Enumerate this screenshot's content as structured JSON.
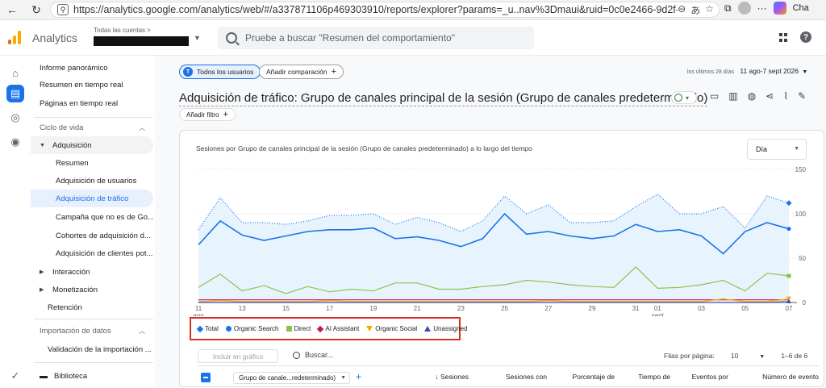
{
  "browser": {
    "url": "https://analytics.google.com/analytics/web/#/a337871106p469303910/reports/explorer?params=_u..nav%3Dmaui&ruid=0c0e2466-9d2f-...",
    "copilot_label": "Cha"
  },
  "header": {
    "brand": "Analytics",
    "account_label": "Todas las cuentas >",
    "search_placeholder": "Pruebe a buscar \"Resumen del comportamiento\""
  },
  "sidebar": {
    "items": [
      {
        "label": "Informe panorámico"
      },
      {
        "label": "Resumen en tiempo real"
      },
      {
        "label": "Páginas en tiempo real"
      },
      {
        "label": "Ciclo de vida"
      },
      {
        "label": "Adquisición"
      },
      {
        "label": "Resumen"
      },
      {
        "label": "Adquisición de usuarios"
      },
      {
        "label": "Adquisición de tráfico"
      },
      {
        "label": "Campaña que no es de Go..."
      },
      {
        "label": "Cohortes de adquisición d..."
      },
      {
        "label": "Adquisición de clientes pot..."
      },
      {
        "label": "Interacción"
      },
      {
        "label": "Monetización"
      },
      {
        "label": "Retención"
      },
      {
        "label": "Importación de datos"
      },
      {
        "label": "Validación de la importación ..."
      },
      {
        "label": "Biblioteca"
      }
    ]
  },
  "main": {
    "chip_users_letter": "T",
    "chip_users": "Todos los usuarios",
    "chip_compare": "Añadir comparación",
    "date_label": "los últimos 28 días",
    "date_value": "11 ago-7 sept 2026",
    "title": "Adquisición de tráfico: Grupo de canales principal de la sesión (Grupo de canales predeterminado)",
    "add_filter": "Añadir filtro",
    "chart_title": "Sesiones por Grupo de canales principal de la sesión (Grupo de canales predeterminado) a lo largo del tiempo",
    "granularity": "Día",
    "table": {
      "include_placeholder": "Incluir en gráfico",
      "search_label": "Buscar...",
      "rows_label": "Filas por página:",
      "rows_value": "10",
      "range": "1–6 de 6",
      "dimension": "Grupo de canale...redeterminado)",
      "columns": [
        "↓ Sesiones",
        "Sesiones con interacción",
        "Porcentaje de interacciones",
        "Tiempo de interacción",
        "Eventos por",
        "Número de evento Todos los eventos"
      ]
    }
  },
  "chart_data": {
    "type": "line",
    "x": [
      "11 ago",
      "12",
      "13",
      "14",
      "15",
      "16",
      "17",
      "18",
      "19",
      "20",
      "21",
      "22",
      "23",
      "24",
      "25",
      "26",
      "27",
      "28",
      "29",
      "30",
      "31",
      "01 sept",
      "02",
      "03",
      "04",
      "05",
      "06",
      "07"
    ],
    "x_tick_labels": [
      "11",
      "ago",
      "13",
      "15",
      "17",
      "19",
      "21",
      "23",
      "25",
      "27",
      "29",
      "31",
      "01",
      "sept",
      "03",
      "05",
      "07"
    ],
    "y_ticks": [
      0,
      50,
      100,
      150
    ],
    "ylim": [
      0,
      150
    ],
    "series": [
      {
        "name": "Total",
        "color": "#1a73e8",
        "style": "dotted-area",
        "values": [
          82,
          118,
          90,
          90,
          88,
          92,
          98,
          98,
          100,
          88,
          96,
          90,
          80,
          92,
          120,
          100,
          110,
          90,
          90,
          92,
          108,
          122,
          100,
          100,
          108,
          84,
          120,
          112
        ]
      },
      {
        "name": "Organic Search",
        "color": "#1a73e8",
        "style": "solid",
        "values": [
          65,
          92,
          76,
          70,
          75,
          80,
          82,
          82,
          84,
          72,
          74,
          70,
          63,
          72,
          100,
          77,
          80,
          75,
          72,
          75,
          88,
          80,
          82,
          75,
          55,
          80,
          90,
          83
        ]
      },
      {
        "name": "Direct",
        "color": "#8bc34a",
        "style": "solid",
        "values": [
          17,
          32,
          13,
          19,
          10,
          18,
          12,
          15,
          13,
          22,
          22,
          15,
          15,
          18,
          20,
          25,
          23,
          20,
          18,
          17,
          40,
          16,
          17,
          20,
          25,
          13,
          33,
          30
        ]
      },
      {
        "name": "AI Assistant",
        "color": "#c2185b",
        "style": "solid",
        "values": [
          3,
          3,
          3,
          3,
          3,
          3,
          3,
          3,
          3,
          3,
          3,
          3,
          3,
          3,
          3,
          3,
          3,
          3,
          3,
          3,
          3,
          3,
          3,
          3,
          3,
          3,
          3,
          3
        ]
      },
      {
        "name": "Organic Social",
        "color": "#f9ab00",
        "style": "solid",
        "values": [
          1,
          2,
          1,
          1,
          1,
          1,
          2,
          1,
          1,
          1,
          1,
          1,
          1,
          1,
          1,
          1,
          2,
          1,
          1,
          1,
          1,
          1,
          1,
          1,
          4,
          1,
          1,
          4
        ]
      },
      {
        "name": "Unassigned",
        "color": "#3c4aa8",
        "style": "solid",
        "values": [
          0,
          0,
          0,
          0,
          0,
          0,
          0,
          0,
          0,
          0,
          0,
          0,
          0,
          0,
          0,
          0,
          0,
          0,
          0,
          0,
          0,
          0,
          0,
          0,
          0,
          0,
          0,
          1
        ]
      }
    ]
  }
}
